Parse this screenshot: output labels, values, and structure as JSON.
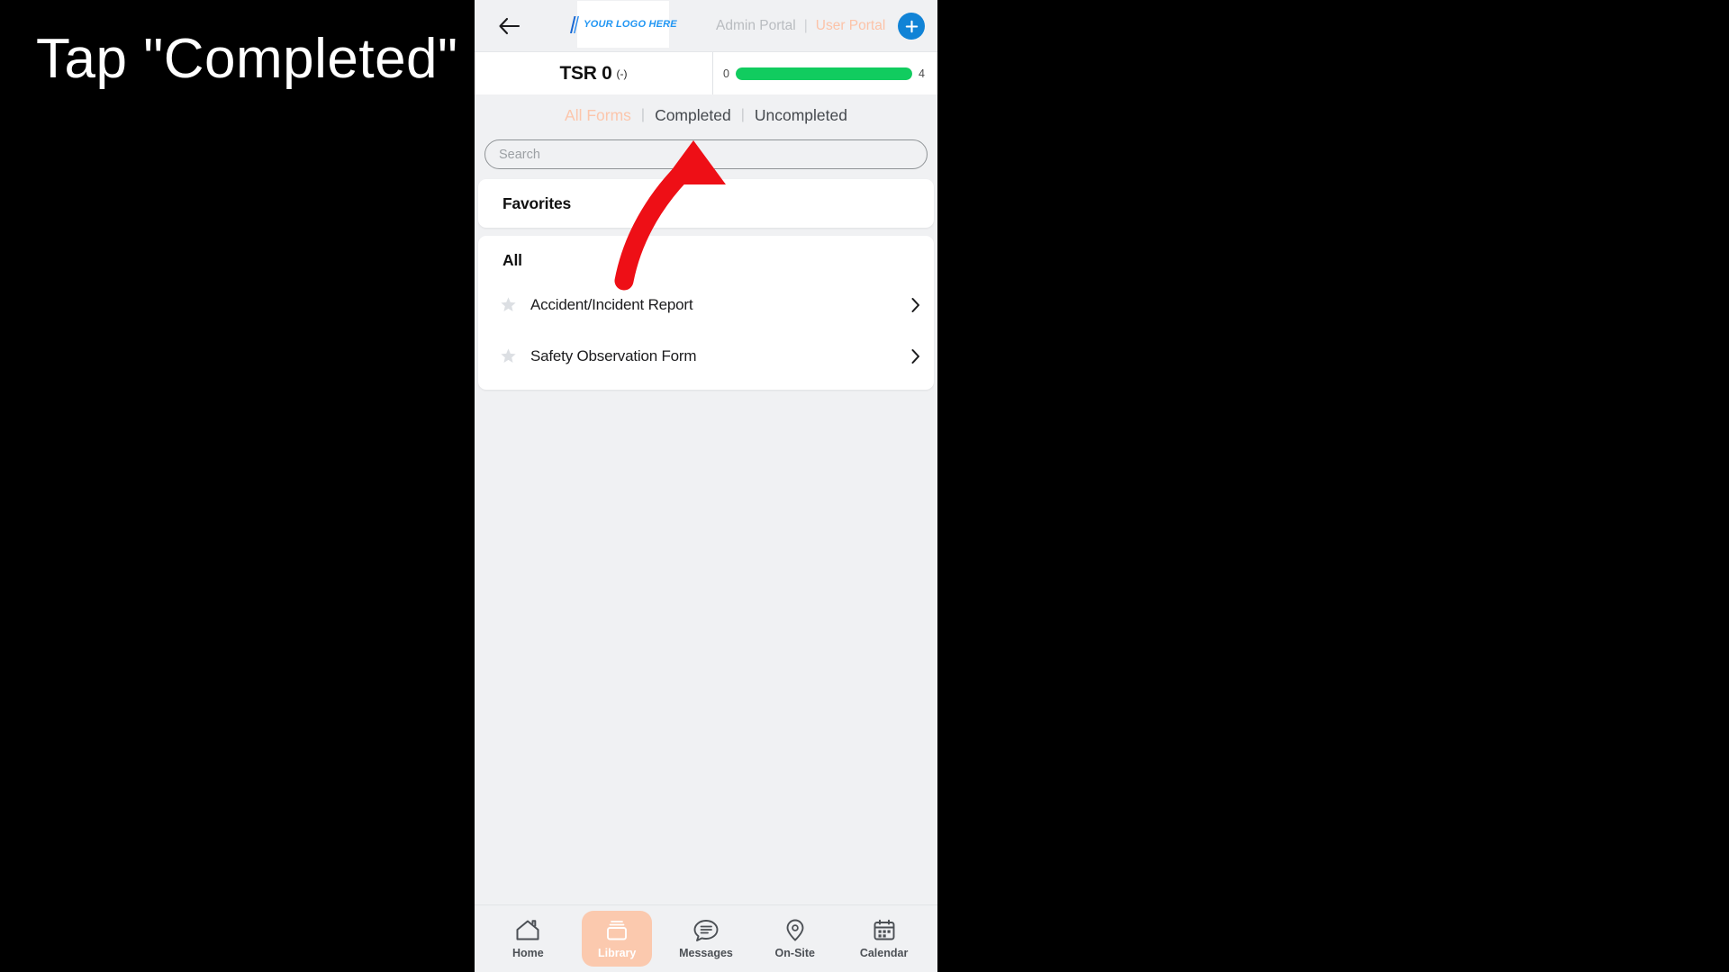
{
  "caption": "Tap \"Completed\"",
  "topbar": {
    "back_icon": "arrow-left-icon",
    "logo_text": "YOUR LOGO HERE",
    "admin_portal": "Admin Portal",
    "separator": "|",
    "user_portal": "User Portal",
    "add_label": "+",
    "accent_blue": "#1183d6",
    "peach": "#fcc3a8"
  },
  "tsr": {
    "label": "TSR 0",
    "sub": "(-)",
    "progress_min": "0",
    "progress_max": "4",
    "progress_percent": 100,
    "bar_color": "#11cc5f"
  },
  "tabs": [
    {
      "label": "All Forms",
      "active": true
    },
    {
      "label": "Completed",
      "active": false
    },
    {
      "label": "Uncompleted",
      "active": false
    }
  ],
  "tab_separator": "|",
  "search": {
    "value": "",
    "placeholder": "Search"
  },
  "favorites": {
    "title": "Favorites",
    "items": []
  },
  "all": {
    "title": "All",
    "items": [
      {
        "name": "Accident/Incident Report",
        "starred": false
      },
      {
        "name": "Safety Observation Form",
        "starred": false
      }
    ]
  },
  "bottom_nav": [
    {
      "label": "Home",
      "icon": "house-icon",
      "active": false
    },
    {
      "label": "Library",
      "icon": "library-icon",
      "active": true
    },
    {
      "label": "Messages",
      "icon": "chat-icon",
      "active": false
    },
    {
      "label": "On-Site",
      "icon": "location-pin-icon",
      "active": false
    },
    {
      "label": "Calendar",
      "icon": "calendar-icon",
      "active": false
    }
  ],
  "annotation": {
    "arrow_color": "#ee0f16",
    "points_to": "Completed"
  }
}
